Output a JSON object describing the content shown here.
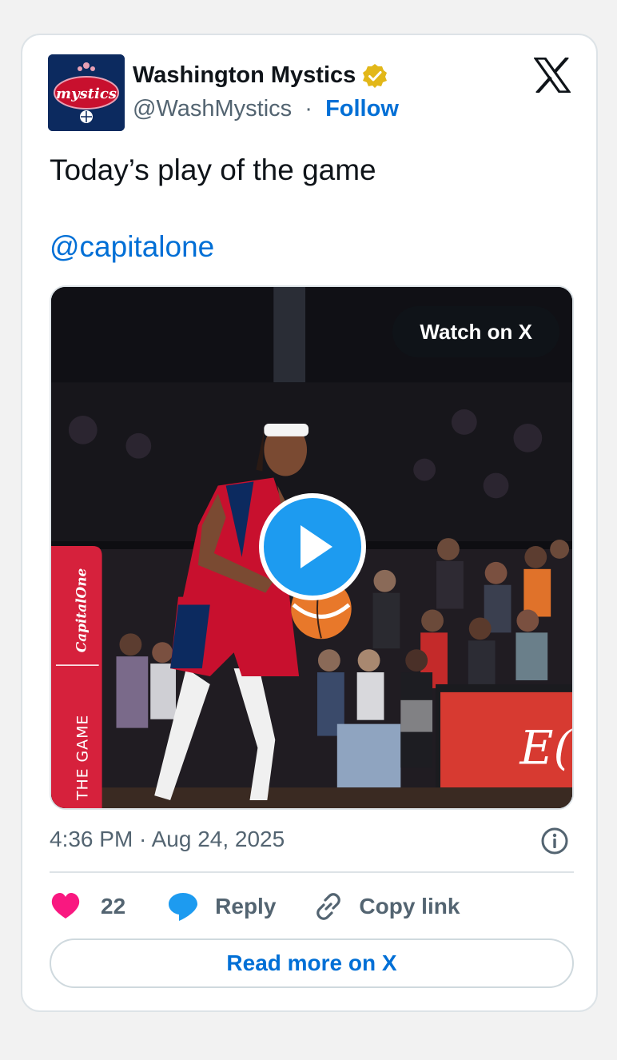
{
  "account": {
    "name": "Washington Mystics",
    "handle": "@WashMystics",
    "separator": "·",
    "follow_label": "Follow",
    "avatar_text": "mystics"
  },
  "tweet": {
    "text": "Today’s play of the game",
    "mention": "@capitalone"
  },
  "media": {
    "watch_label": "Watch on X",
    "banner_brand": "CapitalOne",
    "banner_text": "THE GAME",
    "courtside_sign_text": "E("
  },
  "meta": {
    "timestamp": "4:36 PM · Aug 24, 2025"
  },
  "actions": {
    "like_count": "22",
    "reply_label": "Reply",
    "copy_label": "Copy link"
  },
  "footer": {
    "read_more_label": "Read more on X"
  },
  "colors": {
    "link": "#006fd6",
    "like": "#f91880",
    "reply": "#1d9bf0",
    "verified": "#e2b719",
    "play": "#1d9bf0",
    "mystics_navy": "#0c2a5f",
    "mystics_red": "#c8102e"
  },
  "icons": {
    "verified": "verified-badge-icon",
    "x_logo": "x-logo-icon",
    "play": "play-icon",
    "info": "info-icon",
    "like": "heart-icon",
    "reply": "speech-bubble-icon",
    "copy": "link-icon"
  }
}
